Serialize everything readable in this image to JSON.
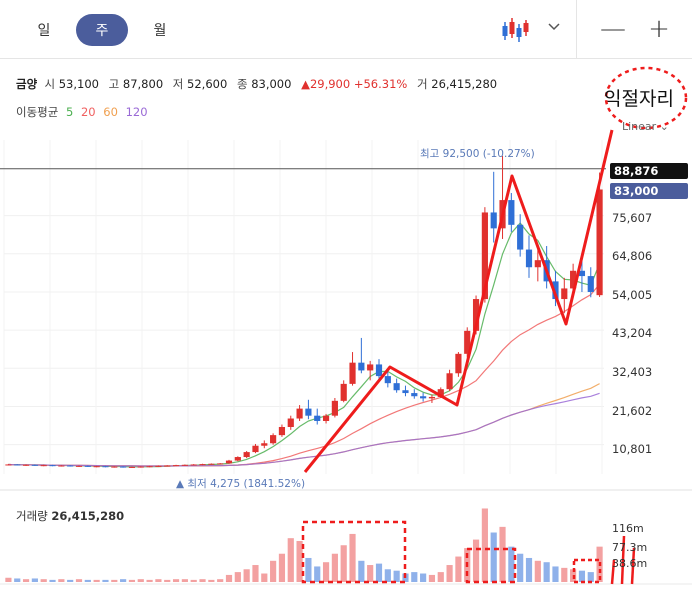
{
  "period_tabs": [
    {
      "label": "일",
      "active": false
    },
    {
      "label": "주",
      "active": true
    },
    {
      "label": "월",
      "active": false
    }
  ],
  "toolbar": {
    "chart_type_icon": "candlestick-icon",
    "dropdown_icon": "chevron-down-icon",
    "zoom_out_label": "—",
    "zoom_in_label": "+"
  },
  "quote": {
    "name": "금양",
    "open_label": "시",
    "open": "53,100",
    "high_label": "고",
    "high": "87,800",
    "low_label": "저",
    "low": "52,600",
    "close_label": "종",
    "close": "83,000",
    "change": "▲29,900",
    "change_pct": "+56.31%",
    "volume_label": "거",
    "volume": "26,415,280"
  },
  "moving_average": {
    "label": "이동평균",
    "periods": [
      {
        "label": "5",
        "color": "#4caf50"
      },
      {
        "label": "20",
        "color": "#f06060"
      },
      {
        "label": "60",
        "color": "#f0a050"
      },
      {
        "label": "120",
        "color": "#9a6ad6"
      }
    ]
  },
  "scale_mode": "Linear",
  "annotation_text": "익절자리",
  "price_tags": {
    "crosshair": "88,876",
    "last": "83,000"
  },
  "high_marker": "최고 92,500 (-10.27%)",
  "low_marker": "▲ 최저 4,275 (1841.52%)",
  "volume_title": "거래량",
  "volume_value": "26,415,280",
  "colors": {
    "up": "#e0312e",
    "down": "#2f6fd6",
    "tab_active": "#4b5d9c",
    "annotation": "#ee1c1c",
    "last_price_box": "#4b5d9c",
    "crosshair_box": "#111111"
  },
  "chart_data": {
    "type": "candlestick",
    "y_ticks": [
      88876,
      83000,
      75607,
      64806,
      54005,
      43204,
      32403,
      21602,
      10801
    ],
    "y_tick_labels": [
      "88,876",
      "83,000",
      "75,607",
      "64,806",
      "54,005",
      "43,204",
      "32,403",
      "21,602",
      "10,801"
    ],
    "ylim": [
      2500,
      97000
    ],
    "volume_ticks": [
      "116m",
      "77.3m",
      "38.6m"
    ],
    "volume_max": 116,
    "highest": 92500,
    "lowest": 4275,
    "series": [
      {
        "name": "candles",
        "values": [
          [
            5100,
            5300,
            4900,
            5200
          ],
          [
            5200,
            5300,
            4900,
            5000
          ],
          [
            5000,
            5200,
            4800,
            5100
          ],
          [
            5100,
            5200,
            4800,
            4900
          ],
          [
            4900,
            5100,
            4700,
            5000
          ],
          [
            5000,
            5100,
            4700,
            4800
          ],
          [
            4800,
            5000,
            4600,
            4900
          ],
          [
            4900,
            5000,
            4600,
            4700
          ],
          [
            4700,
            4900,
            4500,
            4800
          ],
          [
            4800,
            4900,
            4500,
            4600
          ],
          [
            4600,
            4800,
            4400,
            4700
          ],
          [
            4700,
            4800,
            4400,
            4500
          ],
          [
            4500,
            4700,
            4300,
            4600
          ],
          [
            4600,
            4700,
            4300,
            4400
          ],
          [
            4400,
            4600,
            4275,
            4500
          ],
          [
            4500,
            4700,
            4300,
            4600
          ],
          [
            4600,
            4800,
            4400,
            4700
          ],
          [
            4700,
            4900,
            4500,
            4800
          ],
          [
            4800,
            5000,
            4600,
            4900
          ],
          [
            4900,
            5100,
            4700,
            5000
          ],
          [
            5000,
            5200,
            4800,
            5100
          ],
          [
            5100,
            5300,
            4900,
            5200
          ],
          [
            5200,
            5400,
            5000,
            5300
          ],
          [
            5300,
            5500,
            5100,
            5400
          ],
          [
            5400,
            5600,
            5200,
            5500
          ],
          [
            5500,
            6500,
            5400,
            6300
          ],
          [
            6300,
            7500,
            6100,
            7300
          ],
          [
            7300,
            9000,
            7000,
            8700
          ],
          [
            8700,
            11000,
            8400,
            10500
          ],
          [
            10500,
            12000,
            9800,
            11200
          ],
          [
            11200,
            14000,
            10800,
            13500
          ],
          [
            13500,
            16500,
            13000,
            15800
          ],
          [
            15800,
            19000,
            15000,
            18200
          ],
          [
            18200,
            22000,
            17500,
            21000
          ],
          [
            21000,
            23500,
            18000,
            19000
          ],
          [
            19000,
            21000,
            16500,
            17500
          ],
          [
            17500,
            19500,
            16800,
            19000
          ],
          [
            19000,
            24000,
            18500,
            23200
          ],
          [
            23200,
            29000,
            22800,
            28000
          ],
          [
            28000,
            37000,
            27500,
            34000
          ],
          [
            34000,
            41000,
            31000,
            31800
          ],
          [
            31800,
            34500,
            29000,
            33500
          ],
          [
            33500,
            35000,
            29500,
            30200
          ],
          [
            30200,
            31500,
            27000,
            28200
          ],
          [
            28200,
            29500,
            25500,
            26200
          ],
          [
            26200,
            27500,
            24500,
            25400
          ],
          [
            25400,
            26500,
            23800,
            24500
          ],
          [
            24500,
            25500,
            23000,
            23900
          ],
          [
            23900,
            25000,
            22600,
            24300
          ],
          [
            24300,
            27000,
            24000,
            26500
          ],
          [
            26500,
            32000,
            26000,
            31000
          ],
          [
            31000,
            37000,
            30000,
            36500
          ],
          [
            36500,
            44000,
            35500,
            43000
          ],
          [
            43000,
            53000,
            42000,
            52000
          ],
          [
            52000,
            78000,
            51000,
            76500
          ],
          [
            76500,
            88000,
            68000,
            72000
          ],
          [
            72000,
            92500,
            69000,
            80000
          ],
          [
            80000,
            82000,
            71000,
            73000
          ],
          [
            73000,
            76000,
            64000,
            66000
          ],
          [
            66000,
            70000,
            58000,
            61000
          ],
          [
            61000,
            66000,
            57000,
            63000
          ],
          [
            63000,
            67000,
            55000,
            57000
          ],
          [
            57000,
            60000,
            50000,
            52000
          ],
          [
            52000,
            58000,
            48000,
            55000
          ],
          [
            55000,
            62000,
            53000,
            60000
          ],
          [
            60000,
            63000,
            54000,
            58500
          ],
          [
            58500,
            61000,
            52500,
            54000
          ],
          [
            53100,
            87800,
            52600,
            83000
          ]
        ]
      },
      {
        "name": "volume",
        "values": [
          6,
          5,
          4,
          5,
          4,
          3,
          4,
          3,
          4,
          3,
          3,
          3,
          3,
          4,
          3,
          4,
          3,
          4,
          3,
          4,
          4,
          3,
          4,
          3,
          4,
          10,
          14,
          18,
          24,
          12,
          30,
          40,
          62,
          58,
          34,
          22,
          28,
          40,
          52,
          68,
          30,
          24,
          26,
          18,
          16,
          12,
          14,
          12,
          10,
          14,
          24,
          36,
          48,
          60,
          104,
          70,
          78,
          50,
          40,
          34,
          30,
          28,
          22,
          20,
          18,
          16,
          14,
          50
        ]
      }
    ]
  }
}
